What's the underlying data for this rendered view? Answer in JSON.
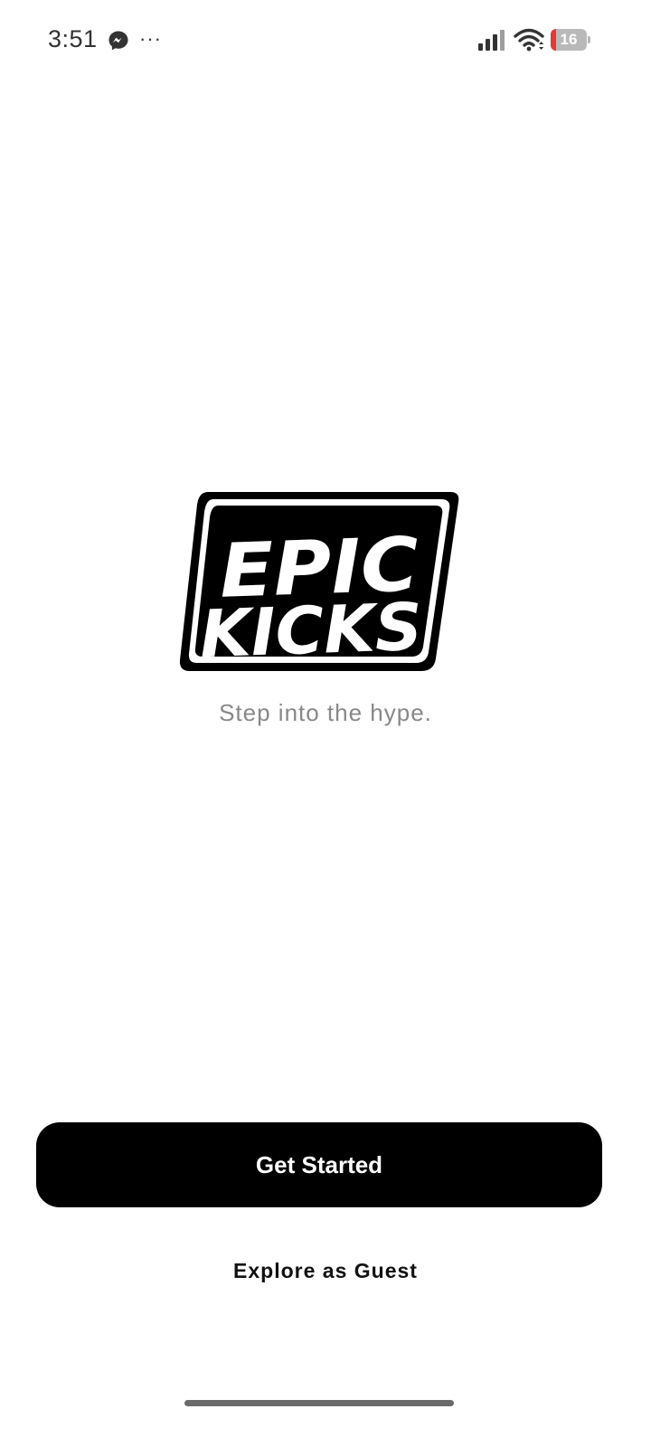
{
  "status_bar": {
    "time": "3:51",
    "notification_icons": [
      "messenger-icon",
      "more-icon"
    ],
    "more_glyph": "···",
    "signal_icon": "signal-icon",
    "wifi_icon": "wifi-icon",
    "battery_level": "16",
    "battery_fraction": 0.16,
    "battery_color": "#e53935"
  },
  "logo": {
    "line1": "EPIC",
    "line2": "KICKS"
  },
  "tagline": "Step into the hype.",
  "actions": {
    "primary_label": "Get Started",
    "secondary_label": "Explore as Guest"
  },
  "colors": {
    "primary_button": "#000000",
    "tagline": "#888888"
  }
}
